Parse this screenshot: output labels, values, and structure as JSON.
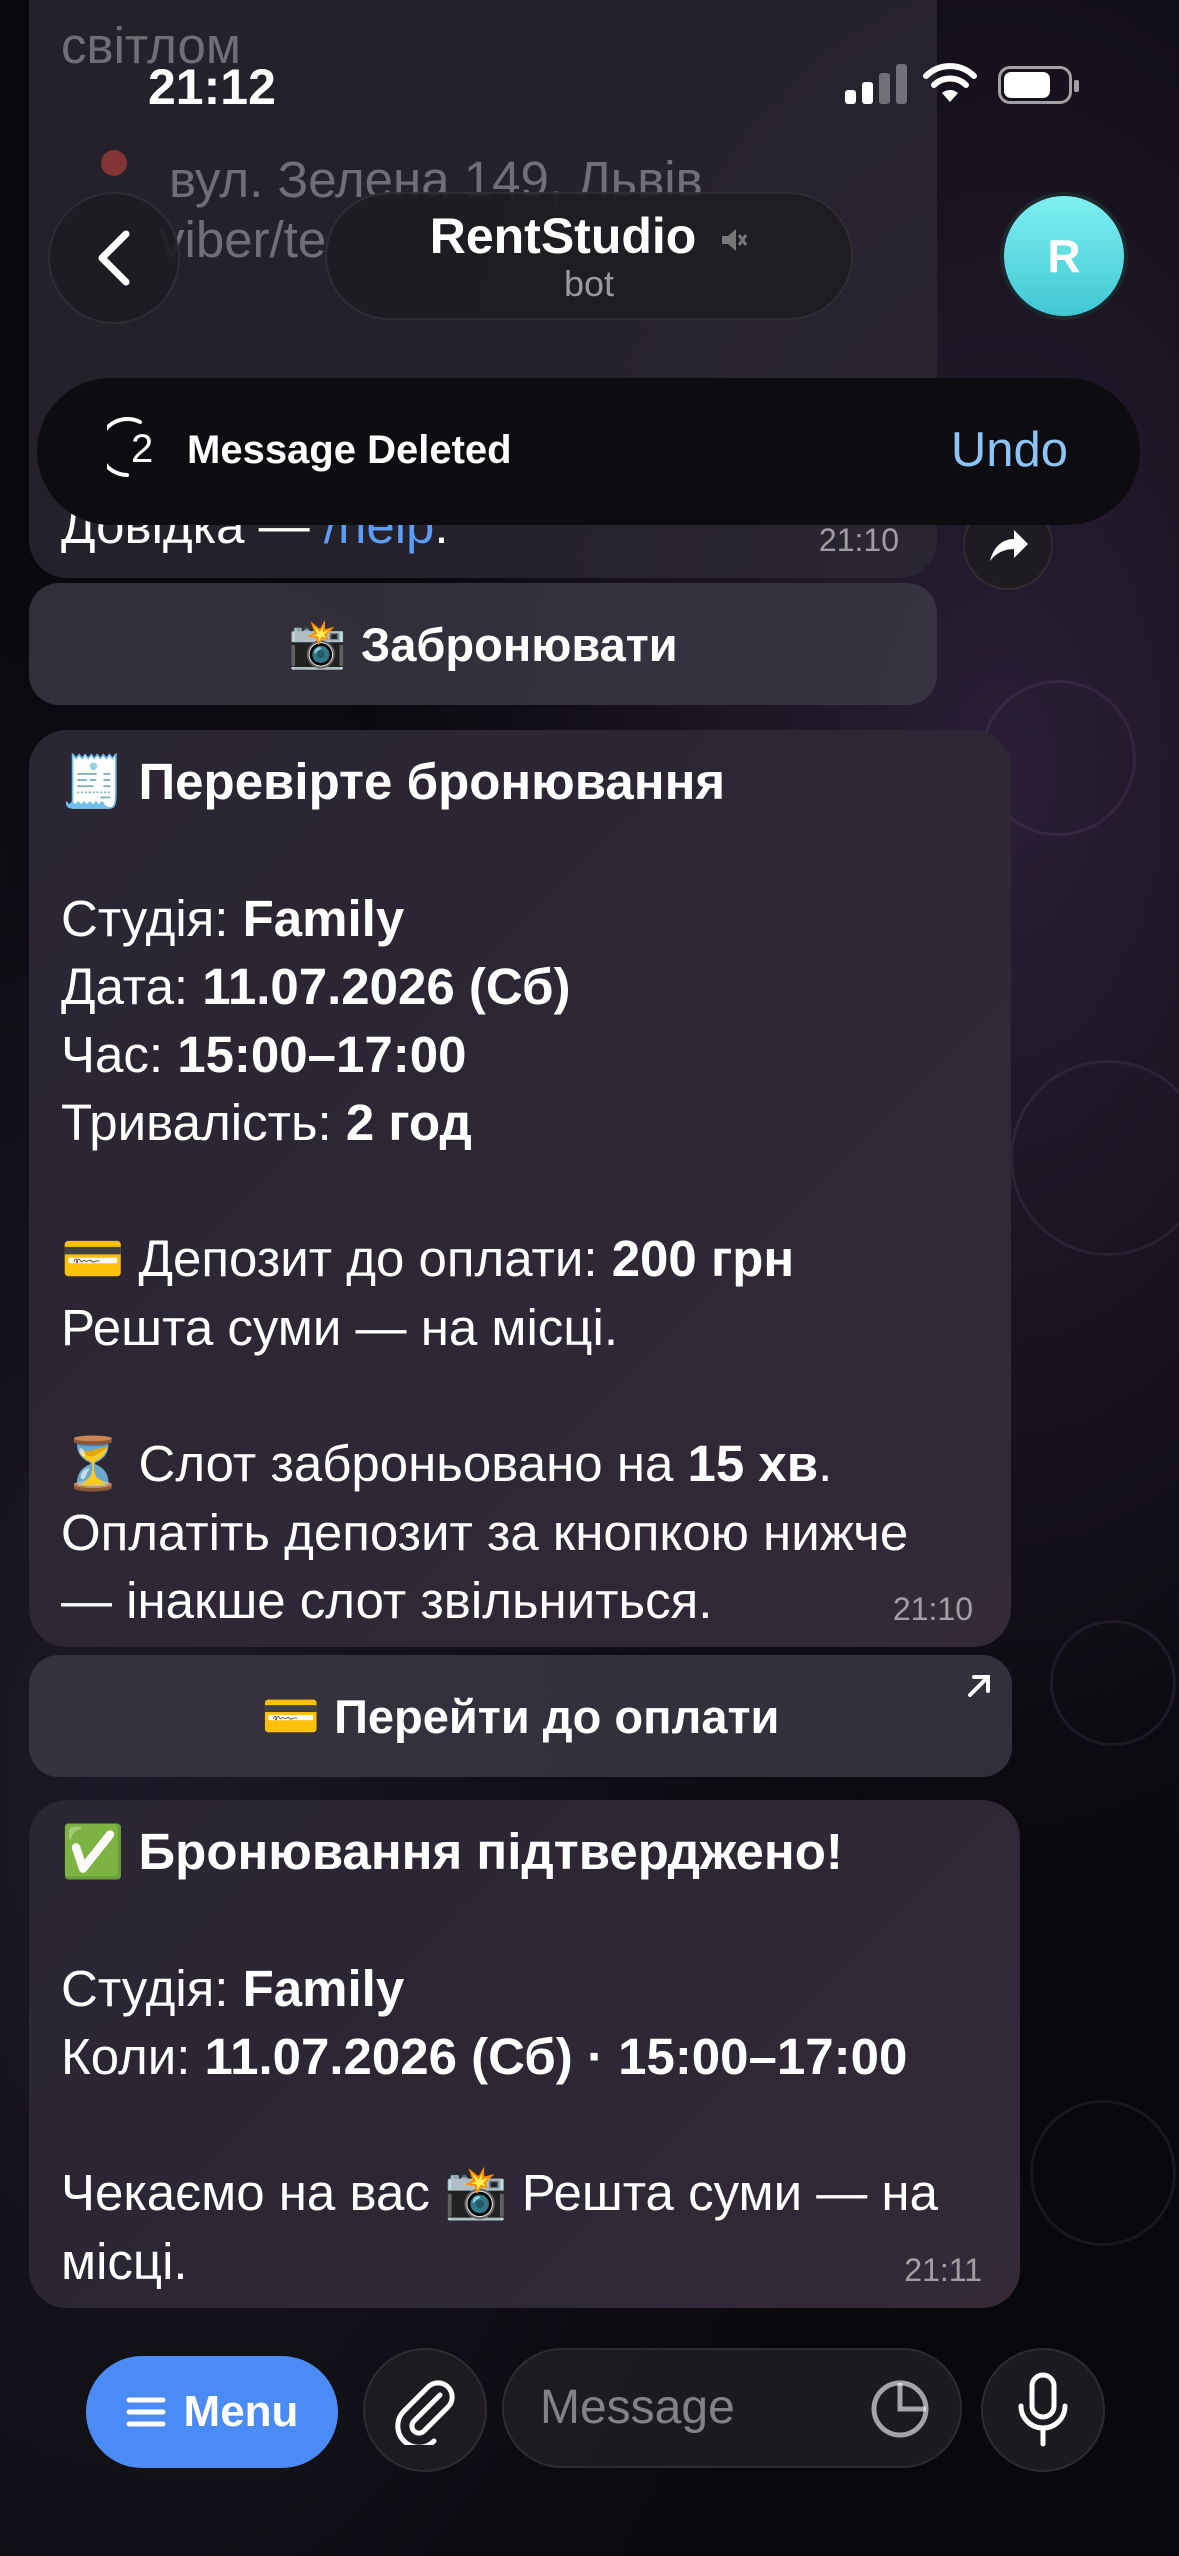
{
  "status_bar": {
    "time": "21:12"
  },
  "header": {
    "title": "RentStudio",
    "subtitle": "bot",
    "avatar_letter": "R",
    "mute_icon": "muted-speaker-icon"
  },
  "background_fragments": {
    "line1": "світлом",
    "line2": "вул. Зелена 149, Львів",
    "line3": "viber/te",
    "line4_prefix": "Довідка — ",
    "line4_link": "/help",
    "line4_suffix": ".",
    "time": "21:10"
  },
  "toast": {
    "countdown": "2",
    "label": "Message Deleted",
    "action": "Undo"
  },
  "buttons": {
    "book": "Забронювати",
    "pay": "Перейти до оплати"
  },
  "message_check": {
    "title": "Перевірте бронювання",
    "studio_label": "Студія: ",
    "studio_value": "Family",
    "date_label": "Дата: ",
    "date_value": "11.07.2026 (Сб)",
    "time_label": "Час: ",
    "time_value": "15:00–17:00",
    "duration_label": "Тривалість: ",
    "duration_value": "2 год",
    "deposit_label": "Депозит до оплати: ",
    "deposit_value": "200 грн",
    "rest_line": "Решта суми — на місці.",
    "slot_prefix": "Слот заброньовано на ",
    "slot_value": "15 хв",
    "slot_suffix": ".",
    "pay_line1": "Оплатіть депозит за кнопкою нижче",
    "pay_line2": "— інакше слот звільниться.",
    "time": "21:10"
  },
  "message_confirm": {
    "title": "Бронювання підтверджено!",
    "studio_label": "Студія: ",
    "studio_value": "Family",
    "when_label": "Коли: ",
    "when_value": "11.07.2026 (Сб) · 15:00–17:00",
    "wait_prefix": "Чекаємо на вас ",
    "wait_suffix": " Решта суми — на",
    "wait_line2": "місці.",
    "time": "21:11"
  },
  "input_bar": {
    "menu_label": "Menu",
    "placeholder": "Message"
  },
  "colors": {
    "accent": "#4a8bf5",
    "link": "#5b9cf5",
    "undo": "#8cc4f7",
    "avatar": "#5ee0e6"
  }
}
